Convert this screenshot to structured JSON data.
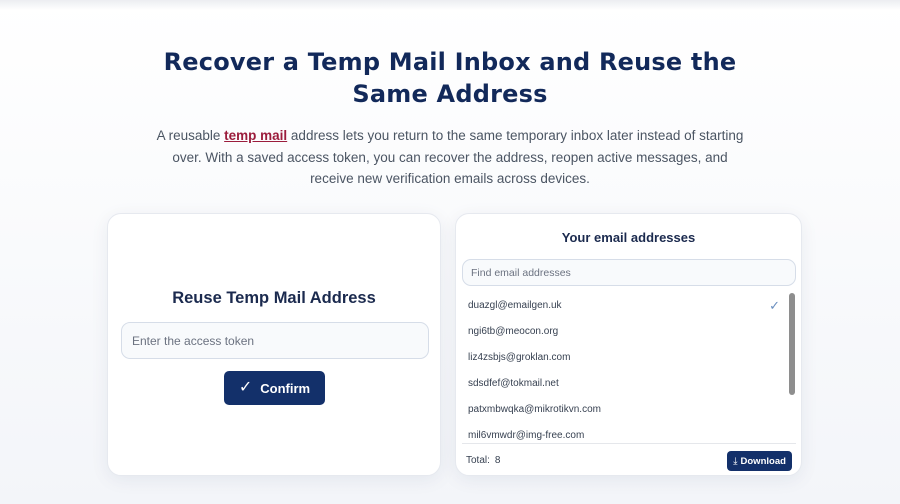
{
  "hero": {
    "title": "Recover a Temp Mail Inbox and Reuse the Same Address",
    "desc_before": "A reusable ",
    "desc_link": "temp mail",
    "desc_after": " address lets you return to the same temporary inbox later instead of starting over. With a saved access token, you can recover the address, reopen active messages, and receive new verification emails across devices."
  },
  "reuse": {
    "title": "Reuse Temp Mail Address",
    "token_placeholder": "Enter the access token",
    "confirm_label": "Confirm",
    "confirm_icon": "check-icon"
  },
  "addresses": {
    "title": "Your email addresses",
    "search_placeholder": "Find email addresses",
    "items": [
      {
        "email": "duazgl@emailgen.uk",
        "selected": true
      },
      {
        "email": "ngi6tb@meocon.org",
        "selected": false
      },
      {
        "email": "liz4zsbjs@groklan.com",
        "selected": false
      },
      {
        "email": "sdsdfef@tokmail.net",
        "selected": false
      },
      {
        "email": "patxmbwqka@mikrotikvn.com",
        "selected": false
      },
      {
        "email": "mil6vmwdr@img-free.com",
        "selected": false
      }
    ],
    "total_label": "Total:",
    "total_count": "8",
    "download_label": "Download",
    "download_icon": "download-icon"
  },
  "colors": {
    "primary": "#13306a",
    "title": "#12295a",
    "link": "#9b1c3c"
  }
}
